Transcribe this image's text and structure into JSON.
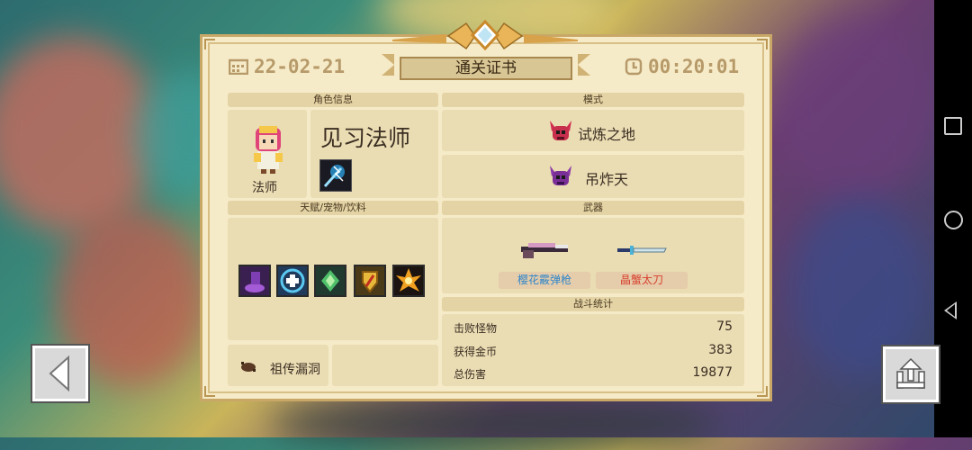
{
  "certificate": {
    "title": "通关证书",
    "date": "22-02-21",
    "time": "00:20:01"
  },
  "sections": {
    "character_info": "角色信息",
    "mode": "模式",
    "talents_pets_drinks": "天赋/宠物/饮料",
    "weapons": "武器",
    "battle_stats": "战斗统计"
  },
  "character": {
    "name": "见习法师",
    "class_label": "法师",
    "skill_icon": "lightning-staff-icon"
  },
  "modes": [
    {
      "label": "试炼之地",
      "icon": "demon-skull-icon"
    },
    {
      "label": "吊炸天",
      "icon": "purple-skull-icon"
    }
  ],
  "talents": [
    "purple-hand-icon",
    "blue-shield-icon",
    "green-gem-icon",
    "golden-shield-icon",
    "fire-burst-icon"
  ],
  "pet": {
    "label": "祖传漏洞",
    "icon": "beetle-icon"
  },
  "weapons": [
    {
      "label": "樱花霰弹枪",
      "color": "#2f86c9",
      "icon": "shotgun-icon"
    },
    {
      "label": "晶蟹太刀",
      "color": "#d8402f",
      "icon": "katana-icon"
    }
  ],
  "stats": [
    {
      "label": "击败怪物",
      "value": "75"
    },
    {
      "label": "获得金币",
      "value": "383"
    },
    {
      "label": "总伤害",
      "value": "19877"
    }
  ],
  "controls": {
    "back_icon": "arrow-left-icon",
    "share_icon": "share-icon"
  },
  "colors": {
    "parchment": "#f6ebc8",
    "border": "#c9a867",
    "header_text": "#b79a6a"
  }
}
